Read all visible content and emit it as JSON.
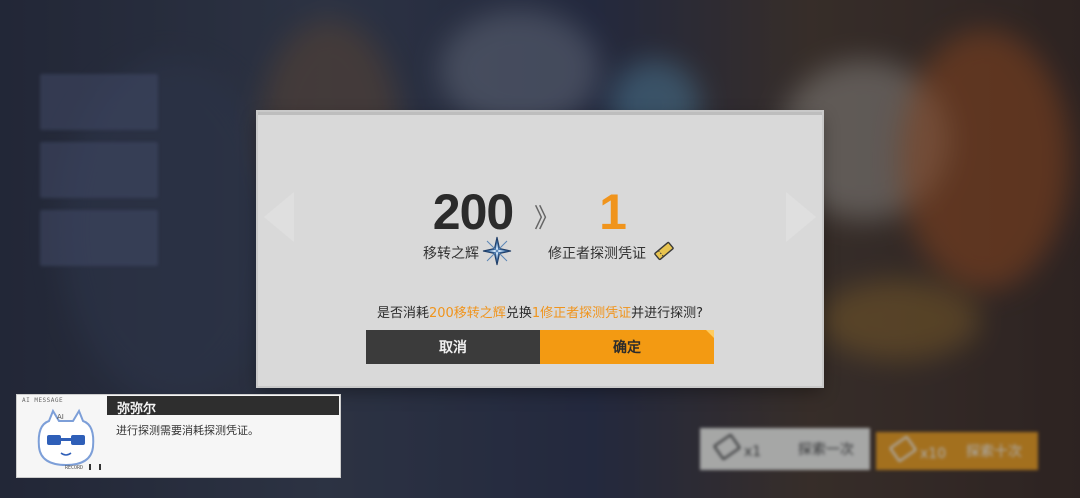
{
  "dialog": {
    "cost_amount": "200",
    "cost_item": "移转之辉",
    "arrows": "》",
    "gain_amount": "1",
    "gain_item": "修正者探测凭证",
    "question_prefix": "是否消耗",
    "question_cost": "200移转之辉",
    "question_mid": "兑换",
    "question_gain": "1修正者探测凭证",
    "question_suffix": "并进行探测?",
    "cancel_label": "取消",
    "confirm_label": "确定",
    "colors": {
      "accent": "#f39a12",
      "highlight": "#f0941c",
      "cancel_bg": "#3b3b3b",
      "panel_bg": "#d9d9d9"
    }
  },
  "message": {
    "tag": "AI MESSAGE",
    "speaker": "弥弥尔",
    "text": "进行探测需要消耗探测凭证。",
    "record_label": "RECORD"
  },
  "background_buttons": {
    "once_count": "x1",
    "once_label": "探索一次",
    "ten_count": "x10",
    "ten_label": "探索十次"
  }
}
